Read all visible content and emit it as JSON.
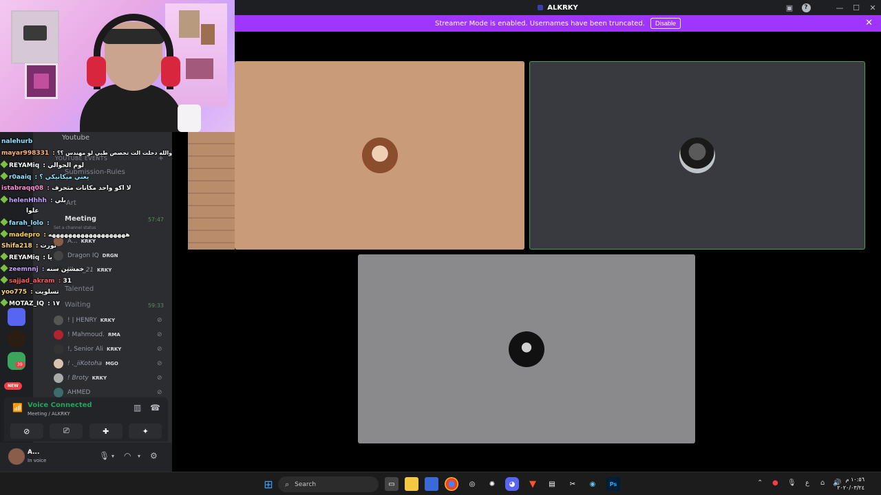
{
  "window": {
    "title": "ALKRKY"
  },
  "notice": {
    "message": "Streamer Mode is enabled. Usernames have been truncated.",
    "disable_label": "Disable"
  },
  "sidebar": {
    "channels": {
      "youtube": "Youtube",
      "youtube_events": "YOUTUBE EVENTS",
      "submission_rules": "Submission-Rules",
      "art": "Art",
      "meeting": "Meeting",
      "meeting_time": "57:47",
      "set_status": "Set a channel status",
      "talented": "Talented",
      "waiting": "Waiting",
      "waiting_time": "59:33"
    },
    "meeting_users": [
      {
        "name": "A...",
        "tag": "KRKY"
      },
      {
        "name": "Dragon IQ",
        "tag": "DRGN"
      },
      {
        "name": "Jihan_21",
        "tag": "KRKY"
      }
    ],
    "waiting_users": [
      {
        "name": "! | HENRY",
        "tag": "KRKY"
      },
      {
        "name": "! Mahmoud.",
        "tag": "RMA"
      },
      {
        "name": "!, Senior Ali",
        "tag": "KRKY"
      },
      {
        "name": "! ._iiKotoha",
        "tag": "MGO"
      },
      {
        "name": "! Broty",
        "tag": "KRKY"
      },
      {
        "name": "AHMED",
        "tag": ""
      }
    ],
    "server_badges": {
      "count": "39",
      "new": "NEW"
    }
  },
  "chat": [
    {
      "name": "nalehurb",
      "text": ""
    },
    {
      "name": "mayar998331",
      "text": "سلار والله دخلت الت تخصص طبي لو مهندس ؟؟"
    },
    {
      "name": "REYAMiq",
      "text": "لوم الحوالي"
    },
    {
      "name": "r0aaiq",
      "text": "يعني ميكانيكي ؟"
    },
    {
      "name": "istabraqq08",
      "text": "لا اكو واحد مكانات متحرف"
    },
    {
      "name": "helenHhhh",
      "text": "بلي"
    },
    {
      "name": "",
      "text": "علوا"
    },
    {
      "name": "farah_lolo",
      "text": ""
    },
    {
      "name": "madepro",
      "text": "هههههههههههههههههههه"
    },
    {
      "name": "Shifa218",
      "text": "تورت"
    },
    {
      "name": "REYAMiq",
      "text": "يا"
    },
    {
      "name": "zeemnnj",
      "text": "خمسين سنه"
    },
    {
      "name": "sajjad_akram",
      "text": "31"
    },
    {
      "name": "yoo775",
      "text": "تسلويت"
    },
    {
      "name": "MOTAZ_IQ",
      "text": "١٧"
    }
  ],
  "voice": {
    "status": "Voice Connected",
    "location": "Meeting / ALKRKY"
  },
  "user": {
    "name": "A...",
    "status": "In voice"
  },
  "taskbar": {
    "search_label": "Search",
    "time": "١٠:٥٦ م",
    "date": "٢٠٢٠/٠٣/٢٤",
    "tray_lang": "ع"
  },
  "colors": {
    "accent": "#a035ff",
    "voice_green": "#23a55a",
    "stage_bg": "#000000"
  }
}
